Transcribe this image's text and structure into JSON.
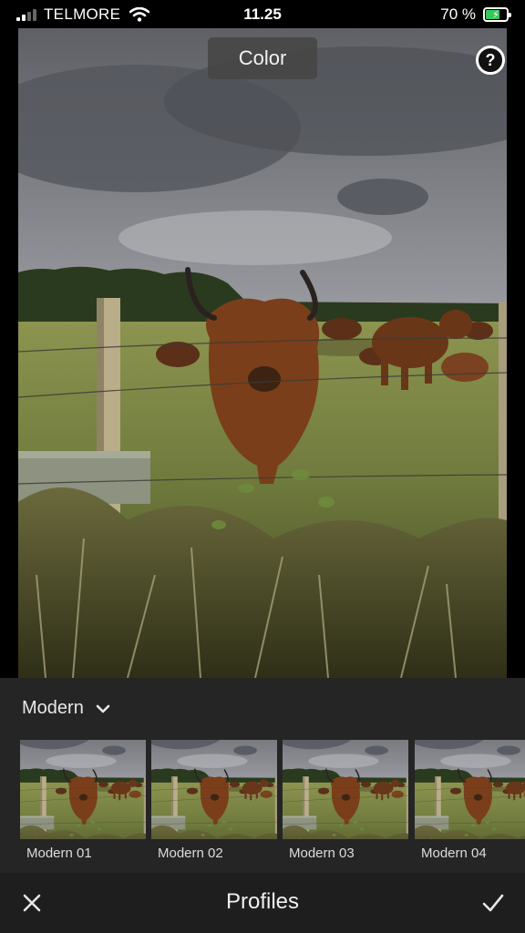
{
  "status_bar": {
    "carrier": "TELMORE",
    "time": "11.25",
    "battery_percent": "70 %",
    "battery_level": 0.7,
    "battery_charging": true
  },
  "editor": {
    "mode_label": "Color",
    "help_label": "?"
  },
  "profiles": {
    "group_label": "Modern",
    "items": [
      {
        "label": "Modern 01"
      },
      {
        "label": "Modern 02"
      },
      {
        "label": "Modern 03"
      },
      {
        "label": "Modern 04"
      }
    ]
  },
  "toolbar": {
    "title": "Profiles",
    "cancel_icon": "close-icon",
    "confirm_icon": "checkmark-icon"
  },
  "colors": {
    "panel_bg": "#252525",
    "toolbar_bg": "#1e1e1e",
    "battery_green": "#34c759"
  }
}
